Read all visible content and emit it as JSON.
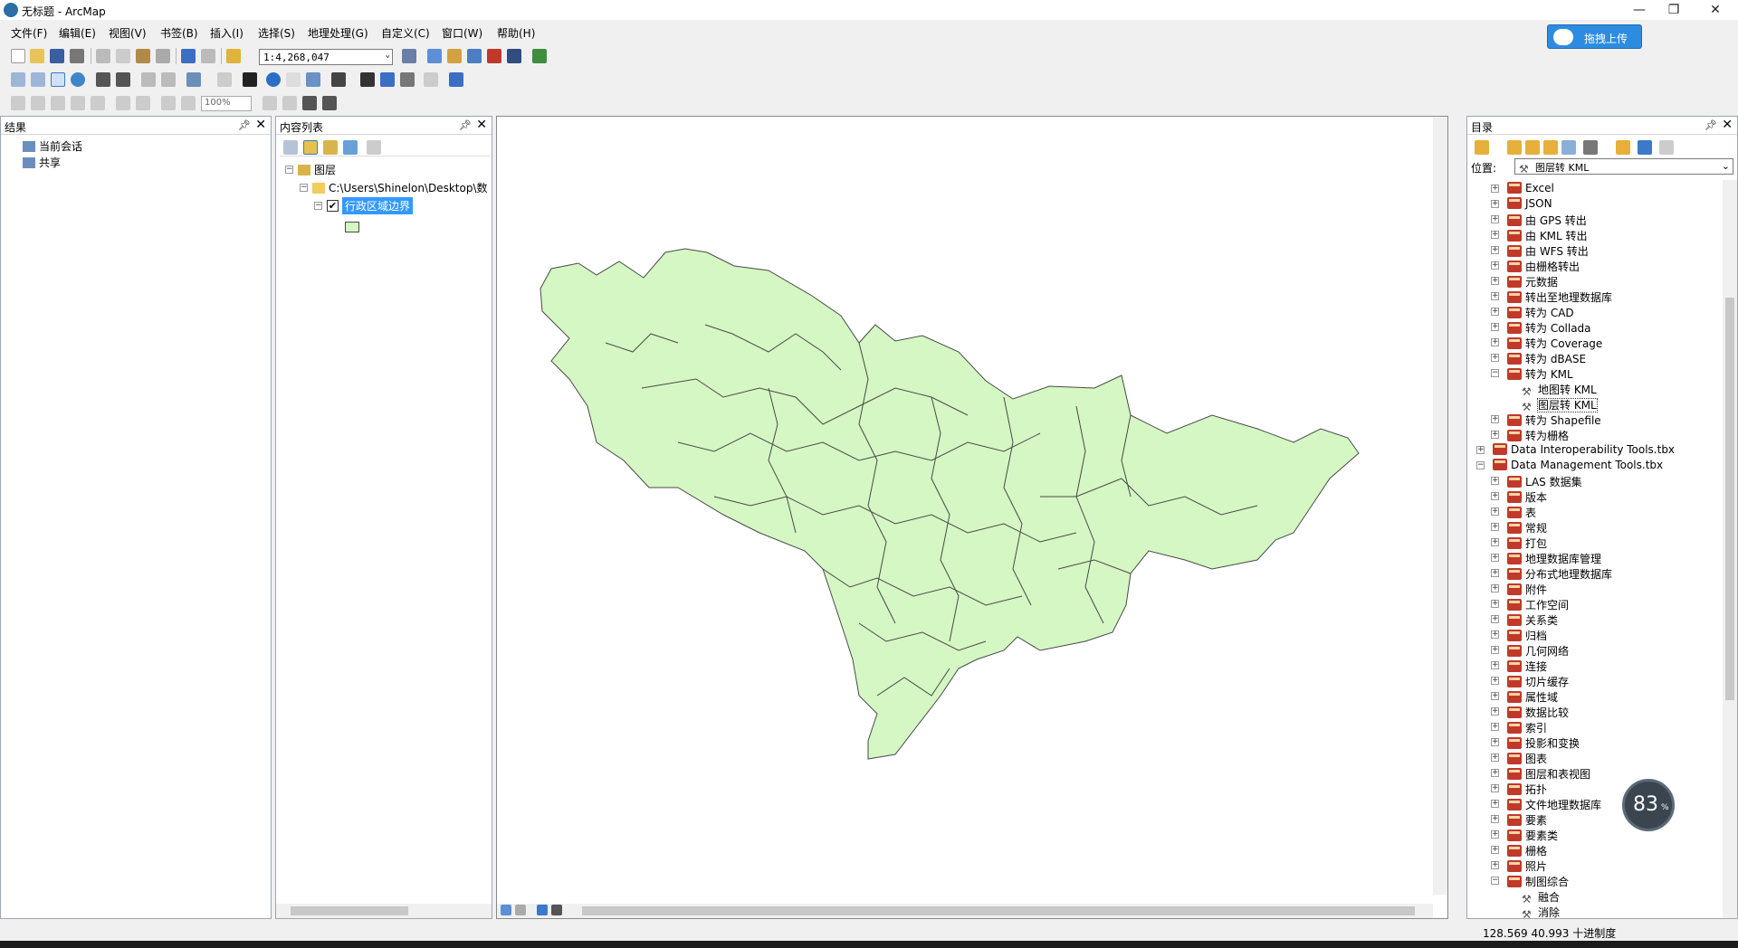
{
  "window": {
    "title": "无标题 - ArcMap",
    "min": "—",
    "restore": "❐",
    "close": "✕"
  },
  "menu": [
    "文件(F)",
    "编辑(E)",
    "视图(V)",
    "书签(B)",
    "插入(I)",
    "选择(S)",
    "地理处理(G)",
    "自定义(C)",
    "窗口(W)",
    "帮助(H)"
  ],
  "toolbar": {
    "scale": "1:4,268,047",
    "zoom": "100%"
  },
  "upload": {
    "label": "拖拽上传"
  },
  "results_panel": {
    "title": "结果",
    "items": [
      "当前会话",
      "共享"
    ]
  },
  "toc_panel": {
    "title": "内容列表",
    "root": "图层",
    "folder": "C:\\Users\\Shinelon\\Desktop\\数",
    "layer": "行政区域边界"
  },
  "catalog_panel": {
    "title": "目录",
    "location_label": "位置:",
    "location_value": "图层转 KML",
    "items": [
      {
        "label": "Excel",
        "type": "toolset",
        "level": 2
      },
      {
        "label": "JSON",
        "type": "toolset",
        "level": 2
      },
      {
        "label": "由 GPS 转出",
        "type": "toolset",
        "level": 2
      },
      {
        "label": "由 KML 转出",
        "type": "toolset",
        "level": 2
      },
      {
        "label": "由 WFS 转出",
        "type": "toolset",
        "level": 2
      },
      {
        "label": "由栅格转出",
        "type": "toolset",
        "level": 2
      },
      {
        "label": "元数据",
        "type": "toolset",
        "level": 2
      },
      {
        "label": "转出至地理数据库",
        "type": "toolset",
        "level": 2
      },
      {
        "label": "转为 CAD",
        "type": "toolset",
        "level": 2
      },
      {
        "label": "转为 Collada",
        "type": "toolset",
        "level": 2
      },
      {
        "label": "转为 Coverage",
        "type": "toolset",
        "level": 2
      },
      {
        "label": "转为 dBASE",
        "type": "toolset",
        "level": 2
      },
      {
        "label": "转为 KML",
        "type": "toolset-open",
        "level": 2
      },
      {
        "label": "地图转 KML",
        "type": "tool",
        "level": 3
      },
      {
        "label": "图层转 KML",
        "type": "tool-selected",
        "level": 3
      },
      {
        "label": "转为 Shapefile",
        "type": "toolset",
        "level": 2
      },
      {
        "label": "转为栅格",
        "type": "toolset",
        "level": 2
      },
      {
        "label": "Data Interoperability Tools.tbx",
        "type": "toolbox",
        "level": 1
      },
      {
        "label": "Data Management Tools.tbx",
        "type": "toolbox-open",
        "level": 1
      },
      {
        "label": "LAS 数据集",
        "type": "toolset",
        "level": 2
      },
      {
        "label": "版本",
        "type": "toolset",
        "level": 2
      },
      {
        "label": "表",
        "type": "toolset",
        "level": 2
      },
      {
        "label": "常规",
        "type": "toolset",
        "level": 2
      },
      {
        "label": "打包",
        "type": "toolset",
        "level": 2
      },
      {
        "label": "地理数据库管理",
        "type": "toolset",
        "level": 2
      },
      {
        "label": "分布式地理数据库",
        "type": "toolset",
        "level": 2
      },
      {
        "label": "附件",
        "type": "toolset",
        "level": 2
      },
      {
        "label": "工作空间",
        "type": "toolset",
        "level": 2
      },
      {
        "label": "关系类",
        "type": "toolset",
        "level": 2
      },
      {
        "label": "归档",
        "type": "toolset",
        "level": 2
      },
      {
        "label": "几何网络",
        "type": "toolset",
        "level": 2
      },
      {
        "label": "连接",
        "type": "toolset",
        "level": 2
      },
      {
        "label": "切片缓存",
        "type": "toolset",
        "level": 2
      },
      {
        "label": "属性域",
        "type": "toolset",
        "level": 2
      },
      {
        "label": "数据比较",
        "type": "toolset",
        "level": 2
      },
      {
        "label": "索引",
        "type": "toolset",
        "level": 2
      },
      {
        "label": "投影和变换",
        "type": "toolset",
        "level": 2
      },
      {
        "label": "图表",
        "type": "toolset",
        "level": 2
      },
      {
        "label": "图层和表视图",
        "type": "toolset",
        "level": 2
      },
      {
        "label": "拓扑",
        "type": "toolset",
        "level": 2
      },
      {
        "label": "文件地理数据库",
        "type": "toolset",
        "level": 2
      },
      {
        "label": "要素",
        "type": "toolset",
        "level": 2
      },
      {
        "label": "要素类",
        "type": "toolset",
        "level": 2
      },
      {
        "label": "栅格",
        "type": "toolset",
        "level": 2
      },
      {
        "label": "照片",
        "type": "toolset",
        "level": 2
      },
      {
        "label": "制图综合",
        "type": "toolset-open",
        "level": 2
      },
      {
        "label": "融合",
        "type": "tool",
        "level": 3
      },
      {
        "label": "消除",
        "type": "tool",
        "level": 3
      }
    ]
  },
  "status": {
    "coords": "128.569  40.993 十进制度"
  },
  "progress": {
    "value": "83",
    "unit": "%"
  },
  "colors": {
    "polygon_fill": "#d4f7c3",
    "polygon_stroke": "#4a4a4a",
    "selection": "#3399ff"
  }
}
